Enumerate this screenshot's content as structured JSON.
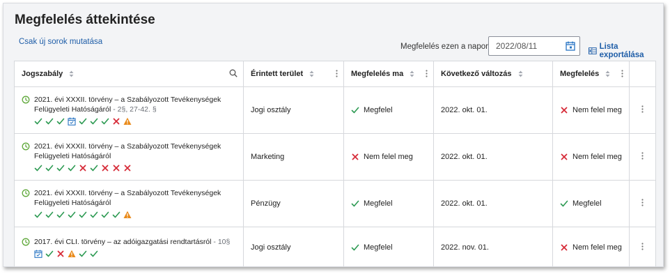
{
  "page": {
    "title": "Megfelelés áttekintése",
    "only_new": "Csak új sorok mutatása"
  },
  "toolbar": {
    "date_label": "Megfelelés ezen a napon:",
    "date_value": "2022/08/11",
    "export_label": "Lista exportálása"
  },
  "columns": [
    "Jogszabály",
    "Érintett terület",
    "Megfelelés ma",
    "Következő változás",
    "Megfelelés"
  ],
  "colors": {
    "check": "#2c9a52",
    "cross": "#d62b38",
    "warn": "#e98a1a",
    "calendar": "#2673c2",
    "clock": "#5fa83a",
    "link": "#1f5ea8"
  },
  "rows": [
    {
      "law": "2021. évi XXXII. törvény – a Szabályozott Tevékenységek Felügyeleti Hatóságáról",
      "section": " - 2§, 27-42. §",
      "icons": [
        "check",
        "check",
        "check",
        "calendar",
        "check",
        "check",
        "check",
        "cross",
        "warning"
      ],
      "area": "Jogi osztály",
      "today": {
        "status": "ok",
        "label": "Megfelel"
      },
      "next": "2022. okt. 01.",
      "final": {
        "status": "fail",
        "label": "Nem felel meg"
      }
    },
    {
      "law": "2021. évi XXXII. törvény – a Szabályozott Tevékenységek Felügyeleti Hatóságáról",
      "section": "",
      "icons": [
        "check",
        "check",
        "check",
        "check",
        "cross",
        "check",
        "cross",
        "cross",
        "cross"
      ],
      "area": "Marketing",
      "today": {
        "status": "fail",
        "label": "Nem felel meg"
      },
      "next": "2022. okt. 01.",
      "final": {
        "status": "fail",
        "label": "Nem felel meg"
      }
    },
    {
      "law": "2021. évi XXXII. törvény – a Szabályozott Tevékenységek Felügyeleti Hatóságáról",
      "section": "",
      "icons": [
        "check",
        "check",
        "check",
        "check",
        "check",
        "check",
        "check",
        "check",
        "warning"
      ],
      "area": "Pénzügy",
      "today": {
        "status": "ok",
        "label": "Megfelel"
      },
      "next": "2022. okt. 01.",
      "final": {
        "status": "ok",
        "label": "Megfelel"
      }
    },
    {
      "law": "2017. évi CLI. törvény – az adóigazgatási rendtartásról",
      "section": " - 10§",
      "icons": [
        "calendar",
        "check",
        "cross",
        "warning",
        "check",
        "check"
      ],
      "area": "Jogi osztály",
      "today": {
        "status": "ok",
        "label": "Megfelel"
      },
      "next": "2022. nov. 01.",
      "final": {
        "status": "fail",
        "label": "Nem felel meg"
      }
    }
  ]
}
